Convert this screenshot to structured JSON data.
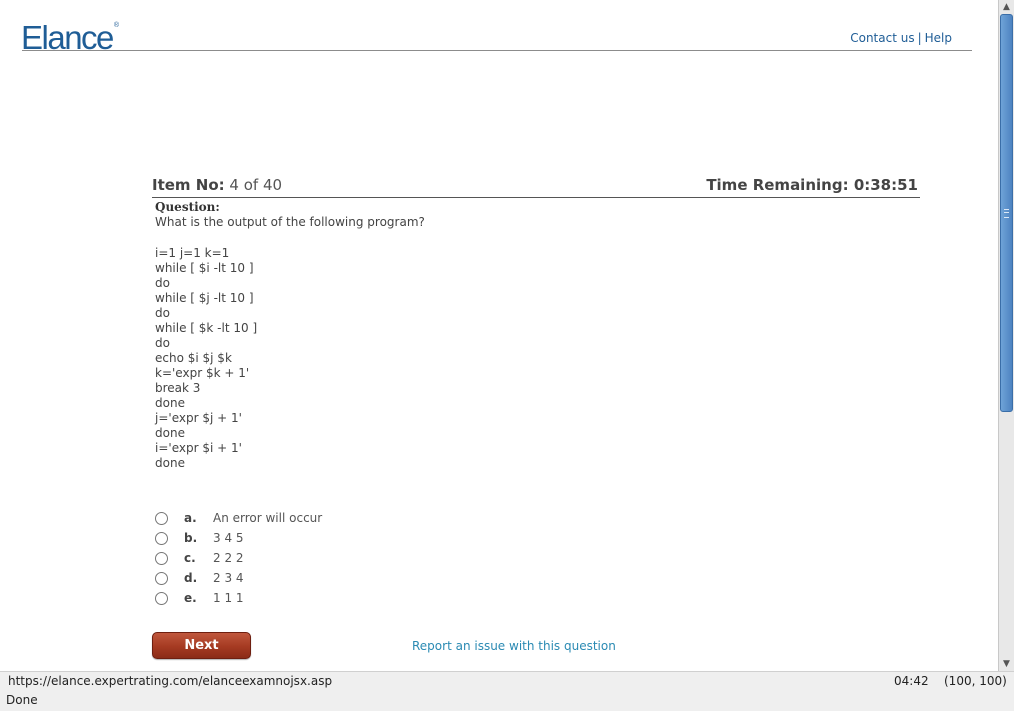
{
  "header": {
    "logo_text": "Elance",
    "logo_mark": "®",
    "contact_link": "Contact us",
    "separator": "|",
    "help_link": "Help"
  },
  "exam": {
    "item_label": "Item No:",
    "item_value": "4 of 40",
    "time_label": "Time Remaining:",
    "time_value": "0:38:51",
    "question_heading": "Question:",
    "question_text": "What is the output of the following program?",
    "code_lines": [
      "i=1 j=1 k=1",
      "while [ $i -lt 10 ]",
      "do",
      "while [ $j -lt 10 ]",
      "do",
      "while [ $k -lt 10 ]",
      "do",
      "echo $i $j $k",
      "k='expr $k + 1'",
      "break 3",
      "done",
      "j='expr $j + 1'",
      "done",
      "i='expr $i + 1'",
      "done"
    ],
    "options": [
      {
        "letter": "a.",
        "text": "An error will occur",
        "selected": false
      },
      {
        "letter": "b.",
        "text": "3 4 5",
        "selected": false
      },
      {
        "letter": "c.",
        "text": "2 2 2",
        "selected": false
      },
      {
        "letter": "d.",
        "text": "2 3 4",
        "selected": false
      },
      {
        "letter": "e.",
        "text": "1 1 1",
        "selected": false
      }
    ],
    "next_label": "Next",
    "report_label": "Report an issue with this question"
  },
  "browser": {
    "url": "https://elance.expertrating.com/elanceexamnojsx.asp",
    "clock": "04:42",
    "coords": "(100, 100)",
    "status": "Done"
  },
  "colors": {
    "brand": "#1f5d96",
    "next_button": "#a53a22",
    "report_link": "#2a8ab3"
  }
}
